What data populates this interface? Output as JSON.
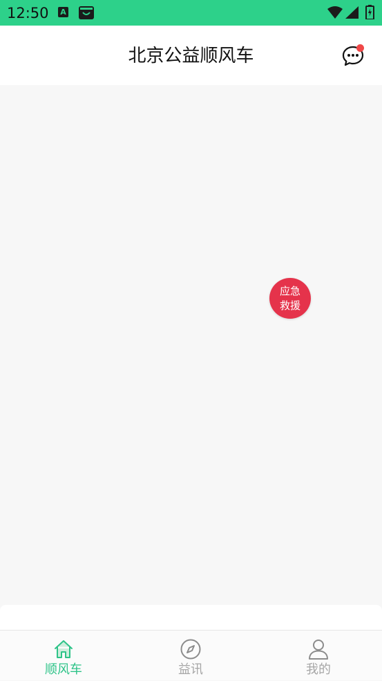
{
  "status_bar": {
    "time": "12:50",
    "notif_icon_letter": "A",
    "icons": [
      "a-notification-icon",
      "bag-notification-icon",
      "wifi-icon",
      "signal-icon",
      "battery-icon"
    ]
  },
  "header": {
    "title": "北京公益顺风车",
    "message_icon": "chat-bubble-icon",
    "has_unread_dot": true
  },
  "content": {
    "sos_button": {
      "line1": "应急",
      "line2": "救援",
      "color": "#e5334b"
    }
  },
  "tabbar": {
    "tabs": [
      {
        "label": "顺风车",
        "icon": "home-icon",
        "active": true
      },
      {
        "label": "益讯",
        "icon": "compass-icon",
        "active": false
      },
      {
        "label": "我的",
        "icon": "user-icon",
        "active": false
      }
    ],
    "active_color": "#2dc388",
    "inactive_color": "#a6a6a6"
  },
  "colors": {
    "status_bar": "#2dd18a",
    "background": "#f7f7f7"
  }
}
